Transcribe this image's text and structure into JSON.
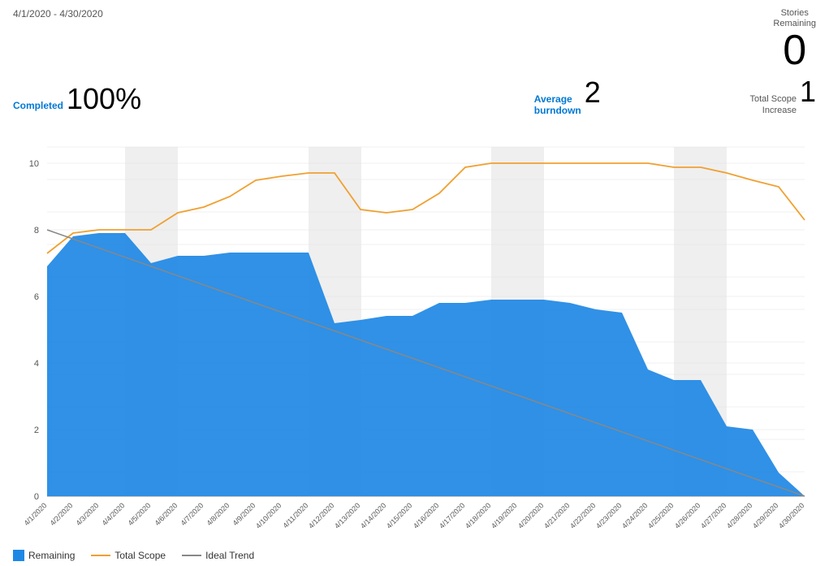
{
  "header": {
    "date_range": "4/1/2020 - 4/30/2020",
    "stories_remaining_label": "Stories\nRemaining",
    "stories_remaining_value": "0"
  },
  "metrics": {
    "completed_label": "Completed",
    "completed_value": "100%",
    "avg_burndown_label": "Average\nburndown",
    "avg_burndown_value": "2",
    "total_scope_label": "Total Scope\nIncrease",
    "total_scope_value": "1"
  },
  "legend": {
    "remaining_label": "Remaining",
    "total_scope_label": "Total Scope",
    "ideal_trend_label": "Ideal Trend"
  },
  "colors": {
    "remaining_fill": "#1e88e5",
    "total_scope_line": "#f0a030",
    "ideal_trend_line": "#888888",
    "weekend_fill": "#e0e0e0",
    "axis_text": "#555555",
    "grid_line": "#e0e0e0"
  }
}
